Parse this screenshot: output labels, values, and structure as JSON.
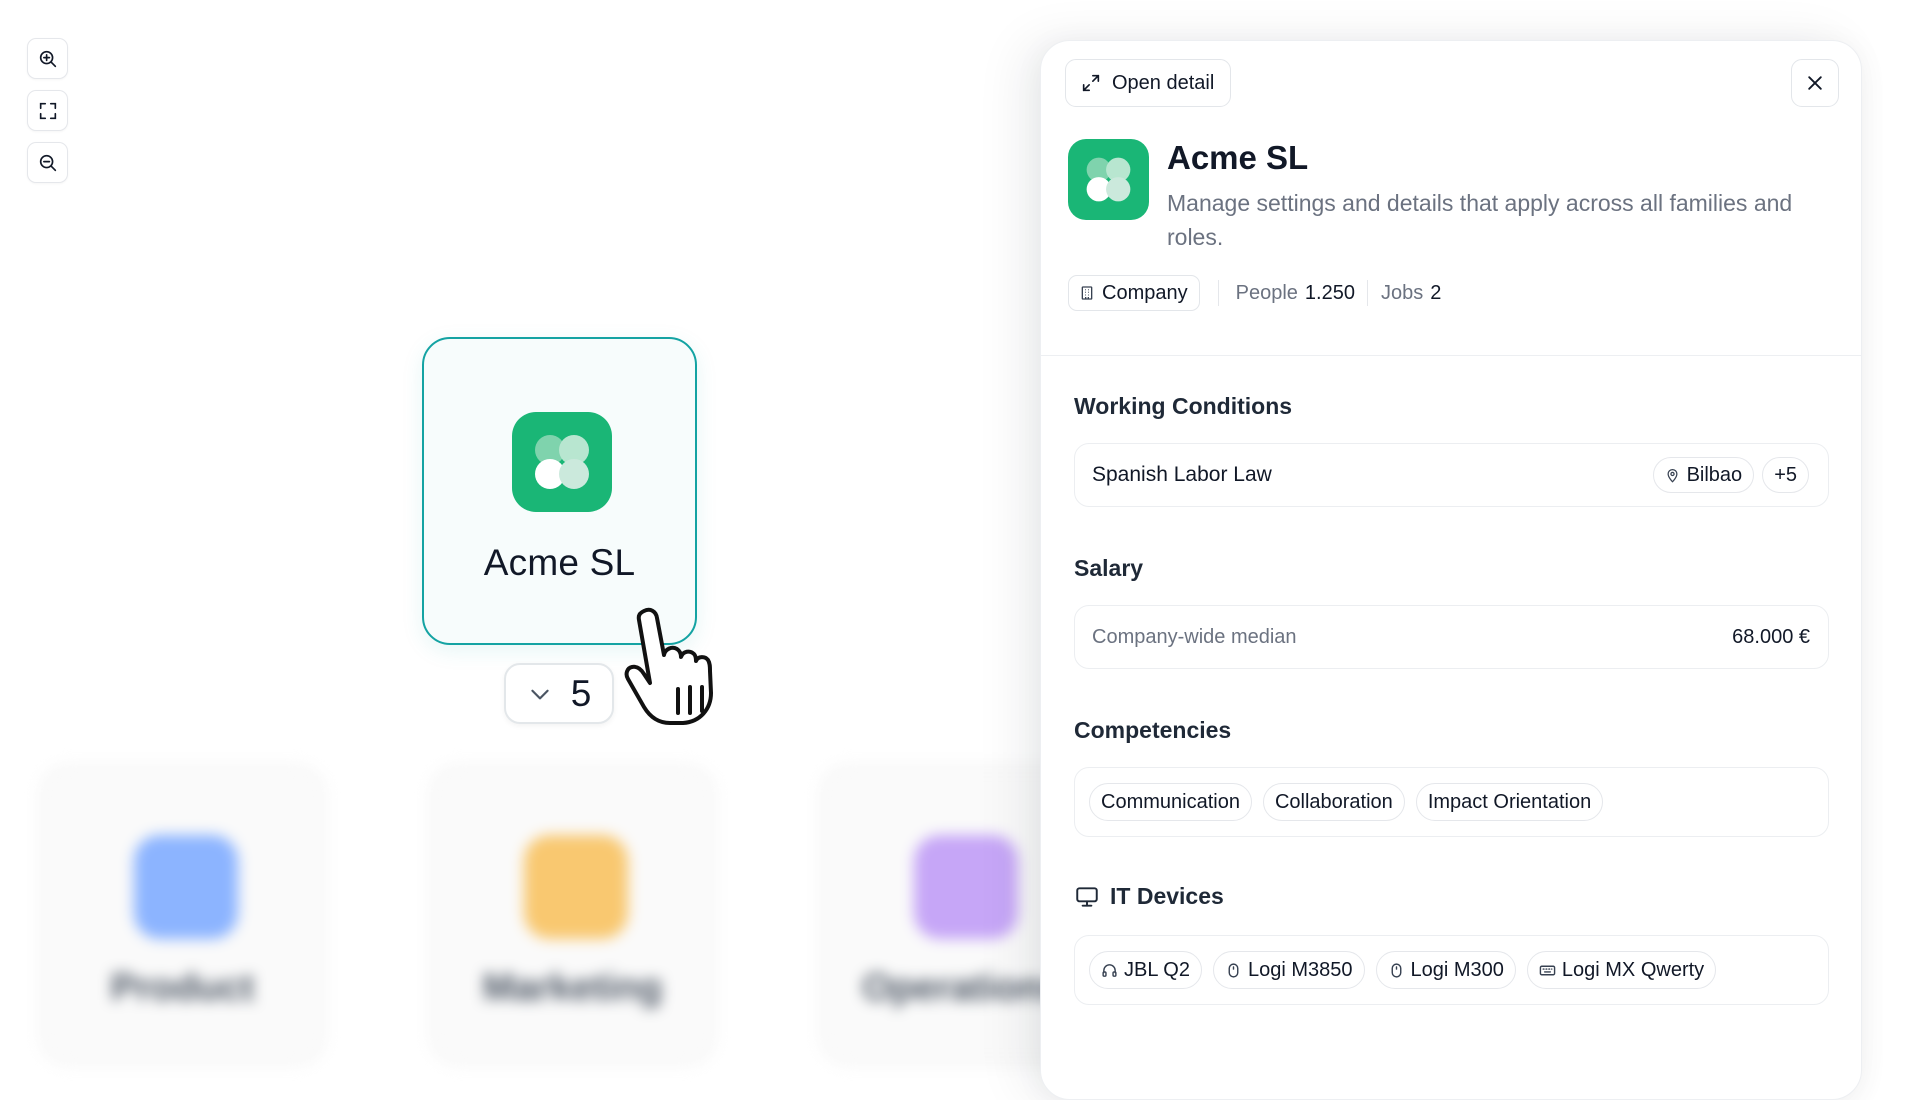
{
  "canvas": {
    "zoom_controls": [
      {
        "name": "zoom-in",
        "icon": "zoom-in-icon"
      },
      {
        "name": "fit-view",
        "icon": "fit-view-icon"
      },
      {
        "name": "zoom-out",
        "icon": "zoom-out-icon"
      }
    ],
    "selected_node": {
      "title": "Acme SL",
      "icon": "clover-logo-icon",
      "child_count": "5",
      "expand_icon": "chevron-down-icon"
    },
    "background_nodes": [
      {
        "label": "Product",
        "color": "#8cb4ff"
      },
      {
        "label": "Marketing",
        "color": "#f9c870"
      },
      {
        "label": "Operations",
        "color": "#c6a6f7"
      }
    ],
    "cursor_icon": "hand-pointer-icon"
  },
  "panel": {
    "open_detail_label": "Open detail",
    "title": "Acme SL",
    "description": "Manage settings and details that apply across all families and roles.",
    "type_label": "Company",
    "people_label": "People",
    "people_value": "1.250",
    "jobs_label": "Jobs",
    "jobs_value": "2",
    "working_conditions": {
      "title": "Working Conditions",
      "law": "Spanish Labor Law",
      "location": "Bilbao",
      "more": "+5"
    },
    "salary": {
      "title": "Salary",
      "label": "Company-wide median",
      "value": "68.000 €"
    },
    "competencies": {
      "title": "Competencies",
      "items": [
        "Communication",
        "Collaboration",
        "Impact Orientation"
      ]
    },
    "it_devices": {
      "title": "IT Devices",
      "items": [
        {
          "label": "JBL Q2",
          "icon": "headphones-icon"
        },
        {
          "label": "Logi M3850",
          "icon": "mouse-icon"
        },
        {
          "label": "Logi M300",
          "icon": "mouse-icon"
        },
        {
          "label": "Logi MX Qwerty",
          "icon": "keyboard-icon"
        }
      ]
    }
  },
  "colors": {
    "brand_green": "#1ab676",
    "selected_border": "#14a3a3"
  }
}
